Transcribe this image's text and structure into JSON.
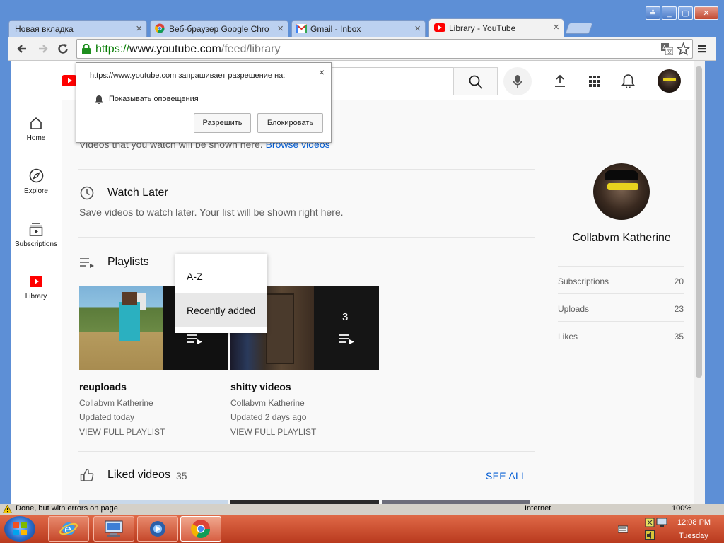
{
  "window": {
    "minimize": "_",
    "maximize": "▢",
    "close": "✕",
    "extra": "≗"
  },
  "tabs": [
    {
      "title": "Новая вкладка"
    },
    {
      "title": "Веб-браузер Google Chro"
    },
    {
      "title": "Gmail - Inbox"
    },
    {
      "title": "Library - YouTube"
    }
  ],
  "toolbar": {
    "url_scheme": "https://",
    "url_host": "www.youtube.com",
    "url_path": "/feed/library"
  },
  "permission_popup": {
    "message": "https://www.youtube.com запрашивает разрешение на:",
    "permission": "Показывать оповещения",
    "allow_label": "Разрешить",
    "block_label": "Блокировать",
    "close": "×"
  },
  "sidebar": {
    "items": [
      {
        "label": "Home",
        "icon": "home-icon"
      },
      {
        "label": "Explore",
        "icon": "compass-icon"
      },
      {
        "label": "Subscriptions",
        "icon": "subscriptions-icon"
      },
      {
        "label": "Library",
        "icon": "library-icon"
      }
    ]
  },
  "history": {
    "text": "Videos that you watch will be shown here.",
    "link": "Browse videos"
  },
  "watch_later": {
    "title": "Watch Later",
    "desc": "Save videos to watch later. Your list will be shown right here."
  },
  "playlists": {
    "title": "Playlists",
    "sort_options": [
      "A-Z",
      "Recently added"
    ],
    "items": [
      {
        "title": "reuploads",
        "channel": "Collabvm Katherine",
        "updated": "Updated today",
        "view": "VIEW FULL PLAYLIST",
        "count": ""
      },
      {
        "title": "shitty videos",
        "channel": "Collabvm Katherine",
        "updated": "Updated 2 days ago",
        "view": "VIEW FULL PLAYLIST",
        "count": "3"
      }
    ]
  },
  "liked": {
    "title": "Liked videos",
    "count": "35",
    "see_all": "SEE ALL"
  },
  "profile": {
    "name": "Collabvm Katherine",
    "stats": [
      {
        "label": "Subscriptions",
        "value": "20"
      },
      {
        "label": "Uploads",
        "value": "23"
      },
      {
        "label": "Likes",
        "value": "35"
      }
    ]
  },
  "status": {
    "text": "Done, but with errors on page.",
    "zone": "Internet",
    "zoom": "100%"
  },
  "taskbar": {
    "time": "12:08 PM",
    "day": "Tuesday"
  },
  "colors": {
    "yt_red": "#ff0000",
    "link_blue": "#065fd4",
    "taskbar": "#c5472a"
  }
}
